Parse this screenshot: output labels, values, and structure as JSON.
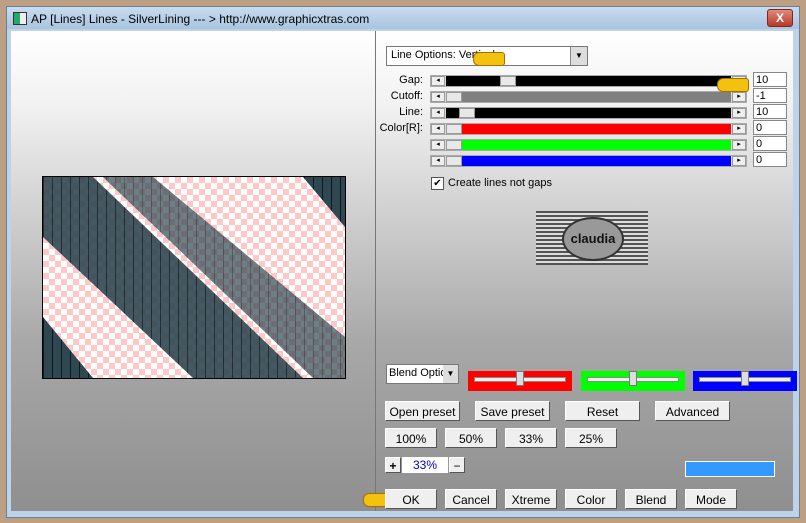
{
  "window": {
    "title": "AP [Lines]  Lines - SilverLining    --- > http://www.graphicxtras.com",
    "close": "X"
  },
  "dropdown": {
    "value": "Line Options: Vertical"
  },
  "sliders": [
    {
      "label": "Gap:",
      "value": "10",
      "color": "#000000",
      "position": 0.2
    },
    {
      "label": "Cutoff:",
      "value": "-1",
      "color": "#808080",
      "position": 0.0
    },
    {
      "label": "Line:",
      "value": "10",
      "color": "#000000",
      "position": 0.05
    },
    {
      "label": "Color[R]:",
      "value": "0",
      "color": "#ff0000",
      "position": 0.0
    },
    {
      "label": "",
      "value": "0",
      "color": "#00ff00",
      "position": 0.0
    },
    {
      "label": "",
      "value": "0",
      "color": "#0000ff",
      "position": 0.0
    }
  ],
  "checkbox": {
    "label": "Create lines not gaps",
    "checked": true
  },
  "logo": {
    "text": "claudia"
  },
  "blend": {
    "dropdown": "Blend Optio",
    "red_level": 0.5,
    "green_level": 0.5,
    "blue_level": 0.5
  },
  "buttons": {
    "open_preset": "Open preset",
    "save_preset": "Save preset",
    "reset": "Reset",
    "advanced": "Advanced",
    "zoom100": "100%",
    "zoom50": "50%",
    "zoom33": "33%",
    "zoom25": "25%",
    "plus": "+",
    "minus": "−",
    "ok": "OK",
    "cancel": "Cancel",
    "xtreme": "Xtreme",
    "color": "Color",
    "blend": "Blend",
    "mode": "Mode"
  },
  "zoom_value": "33%",
  "color_swatch": "#3399ff"
}
